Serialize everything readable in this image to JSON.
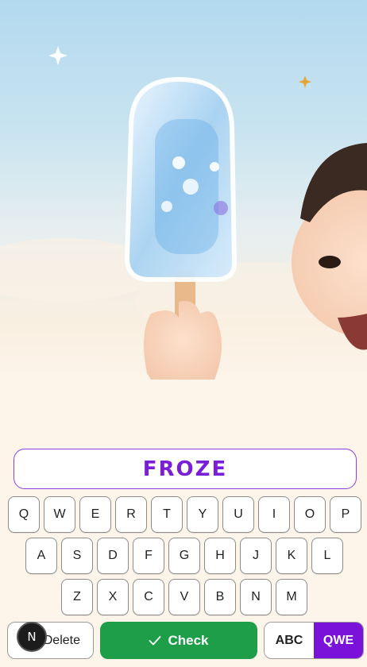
{
  "answer": {
    "word": "FROZE"
  },
  "keyboard": {
    "row1": [
      "Q",
      "W",
      "E",
      "R",
      "T",
      "Y",
      "U",
      "I",
      "O",
      "P"
    ],
    "row2": [
      "A",
      "S",
      "D",
      "F",
      "G",
      "H",
      "J",
      "K",
      "L"
    ],
    "row3": [
      "Z",
      "X",
      "C",
      "V",
      "B",
      "N",
      "M"
    ]
  },
  "actions": {
    "delete_label": "Delete",
    "check_label": "Check",
    "layout_abc": "ABC",
    "layout_qwe": "QWE",
    "active_layout": "QWE"
  },
  "avatar": {
    "initial": "N"
  },
  "colors": {
    "accent": "#7a12d9",
    "check": "#1f9e4a",
    "answer_text": "#7a1fd6"
  }
}
